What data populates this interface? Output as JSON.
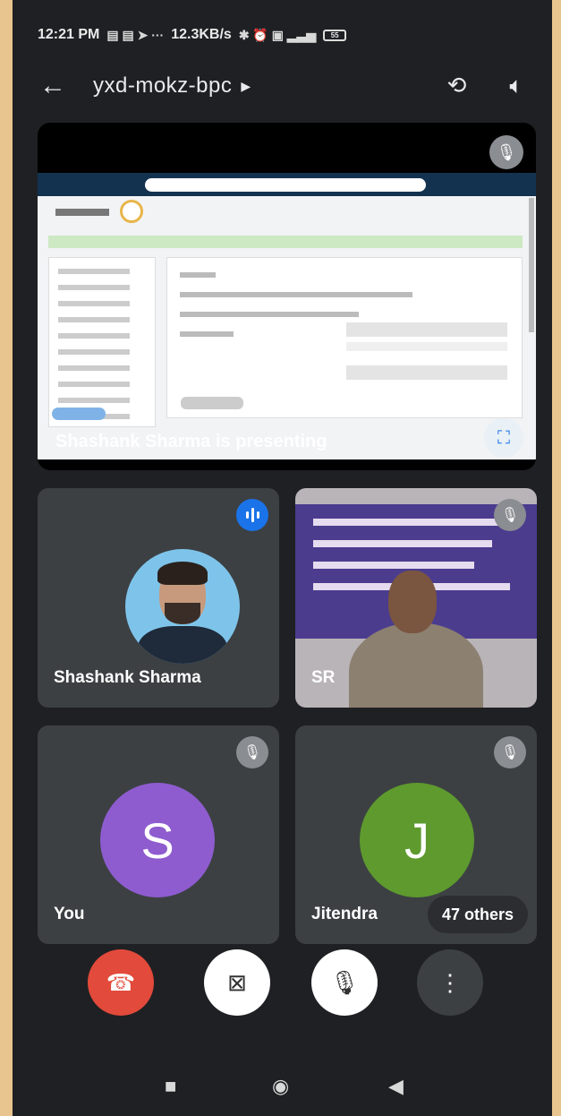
{
  "status_bar": {
    "time": "12:21 PM",
    "net_speed": "12.3KB/s",
    "battery": "55"
  },
  "topbar": {
    "meeting_code": "yxd-mokz-bpc",
    "icons": [
      "back-arrow-icon",
      "switch-camera-icon",
      "speaker-icon"
    ]
  },
  "presentation": {
    "label": "Shashank Sharma is presenting"
  },
  "participants": [
    {
      "name": "Shashank Sharma",
      "state": "speaking"
    },
    {
      "name": "SR",
      "state": "muted"
    },
    {
      "name": "You",
      "initial": "S",
      "color": "#8e5ccf",
      "state": "muted"
    },
    {
      "name": "Jitendra",
      "initial": "J",
      "color": "#5e9a2e",
      "state": "muted"
    }
  ],
  "others_label": "47 others",
  "colors": {
    "end_call": "#e24a3b",
    "control_light": "#ffffff",
    "control_dark": "#3c4043",
    "speaking": "#1a73e8"
  },
  "controls": [
    "end-call",
    "camera-off",
    "mic-off",
    "more-options"
  ]
}
